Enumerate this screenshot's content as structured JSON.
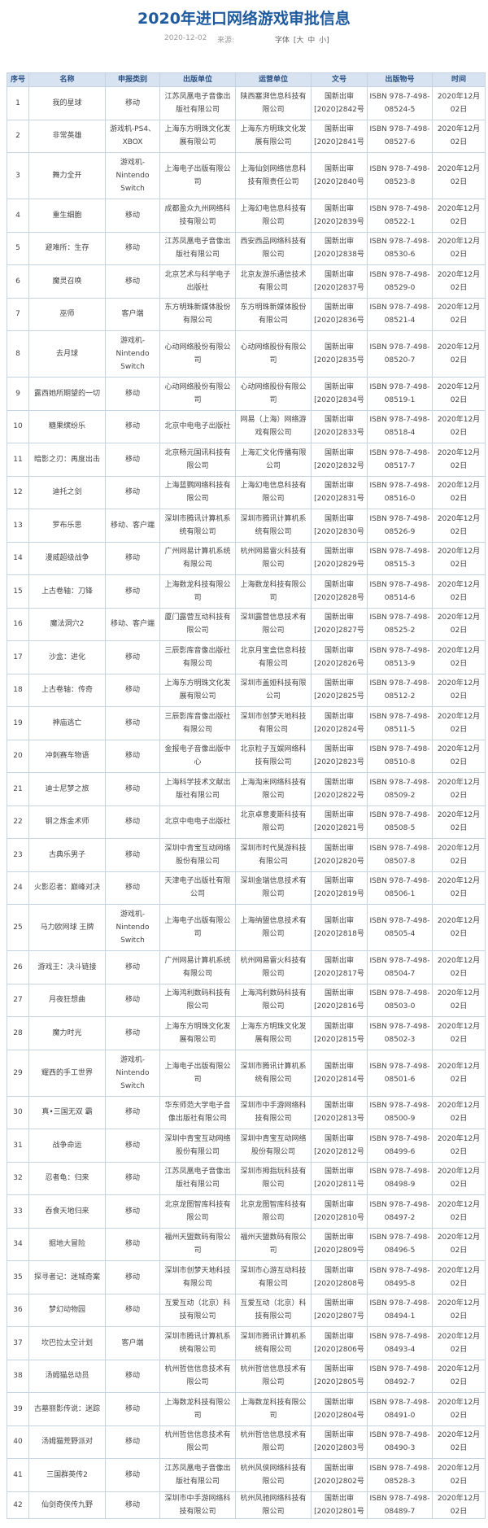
{
  "title": "2020年进口网络游戏审批信息",
  "meta": {
    "date": "2020-12-02",
    "source_label": "来源:",
    "font_label": "字体",
    "font_sizes": [
      "[大",
      "中",
      "小]"
    ]
  },
  "headers": [
    "序号",
    "名称",
    "申报类别",
    "出版单位",
    "运营单位",
    "文号",
    "出版物号",
    "时间"
  ],
  "rows": [
    [
      "1",
      "我的星球",
      "移动",
      "江苏凤凰电子音像出版社有限公司",
      "陕西塞湃信息科技有限公司",
      "国新出审[2020]2842号",
      "ISBN 978-7-498-08524-5",
      "2020年12月02日"
    ],
    [
      "2",
      "非常英雄",
      "游戏机-PS4、XBOX",
      "上海东方明珠文化发展有限公司",
      "上海东方明珠文化发展有限公司",
      "国新出审[2020]2841号",
      "ISBN 978-7-498-08527-6",
      "2020年12月02日"
    ],
    [
      "3",
      "舞力全开",
      "游戏机-Nintendo Switch",
      "上海电子出版有限公司",
      "上海仙剑网络信息科技有限责任公司",
      "国新出审[2020]2840号",
      "ISBN 978-7-498-08523-8",
      "2020年12月02日"
    ],
    [
      "4",
      "重生细胞",
      "移动",
      "成都盈众九州网络科技有限公司",
      "上海幻电信息科技有限公司",
      "国新出审[2020]2839号",
      "ISBN 978-7-498-08522-1",
      "2020年12月02日"
    ],
    [
      "5",
      "避难所：生存",
      "移动",
      "江苏凤凰电子音像出版社有限公司",
      "西安西品网络科技有限公司",
      "国新出审[2020]2838号",
      "ISBN 978-7-498-08530-6",
      "2020年12月02日"
    ],
    [
      "6",
      "魔灵召唤",
      "移动",
      "北京艺术与科学电子出版社",
      "北京友游乐通信技术有限公司",
      "国新出审[2020]2837号",
      "ISBN 978-7-498-08529-0",
      "2020年12月02日"
    ],
    [
      "7",
      "巫师",
      "客户端",
      "东方明珠新媒体股份有限公司",
      "东方明珠新媒体股份有限公司",
      "国新出审[2020]2836号",
      "ISBN 978-7-498-08521-4",
      "2020年12月02日"
    ],
    [
      "8",
      "去月球",
      "游戏机-Nintendo Switch",
      "心动网络股份有限公司",
      "心动网络股份有限公司",
      "国新出审[2020]2835号",
      "ISBN 978-7-498-08520-7",
      "2020年12月02日"
    ],
    [
      "9",
      "露西她所期望的一切",
      "移动",
      "心动网络股份有限公司",
      "心动网络股份有限公司",
      "国新出审[2020]2834号",
      "ISBN 978-7-498-08519-1",
      "2020年12月02日"
    ],
    [
      "10",
      "糖果缤纷乐",
      "移动",
      "北京中电电子出版社",
      "网易（上海）网络游戏有限公司",
      "国新出审[2020]2833号",
      "ISBN 978-7-498-08518-4",
      "2020年12月02日"
    ],
    [
      "11",
      "暗影之刃：再度出击",
      "移动",
      "北京畅元国讯科技有限公司",
      "上海汇文化传播有限公司",
      "国新出审[2020]2832号",
      "ISBN 978-7-498-08517-7",
      "2020年12月02日"
    ],
    [
      "12",
      "迪托之剑",
      "移动",
      "上海蓝鹦网络科技有限公司",
      "上海幻电信息科技有限公司",
      "国新出审[2020]2831号",
      "ISBN 978-7-498-08516-0",
      "2020年12月02日"
    ],
    [
      "13",
      "罗布乐思",
      "移动、客户端",
      "深圳市腾讯计算机系统有限公司",
      "深圳市腾讯计算机系统有限公司",
      "国新出审[2020]2830号",
      "ISBN 978-7-498-08526-9",
      "2020年12月02日"
    ],
    [
      "14",
      "漫威超级战争",
      "移动",
      "广州网易计算机系统有限公司",
      "杭州网易雷火科技有限公司",
      "国新出审[2020]2829号",
      "ISBN 978-7-498-08515-3",
      "2020年12月02日"
    ],
    [
      "15",
      "上古卷轴：刀锋",
      "移动",
      "上海数龙科技有限公司",
      "上海数龙科技有限公司",
      "国新出审[2020]2828号",
      "ISBN 978-7-498-08514-6",
      "2020年12月02日"
    ],
    [
      "16",
      "魔法洞穴2",
      "移动、客户端",
      "厦门露营互动科技有限公司",
      "深圳露营信息技术有限公司",
      "国新出审[2020]2827号",
      "ISBN 978-7-498-08525-2",
      "2020年12月02日"
    ],
    [
      "17",
      "沙盒：进化",
      "移动",
      "三辰影库音像出版社有限公司",
      "北京月宝盒信息科技有限公司",
      "国新出审[2020]2826号",
      "ISBN 978-7-498-08513-9",
      "2020年12月02日"
    ],
    [
      "18",
      "上古卷轴：传奇",
      "移动",
      "上海东方明珠文化发展有限公司",
      "深圳市盖娅科技有限公司",
      "国新出审[2020]2825号",
      "ISBN 978-7-498-08512-2",
      "2020年12月02日"
    ],
    [
      "19",
      "神庙逃亡",
      "移动",
      "三辰影库音像出版社有限公司",
      "深圳市创梦天地科技有限公司",
      "国新出审[2020]2824号",
      "ISBN 978-7-498-08511-5",
      "2020年12月02日"
    ],
    [
      "20",
      "冲刺赛车物语",
      "移动",
      "金报电子音像出版中心",
      "北京粒子互娱网络科技有限公司",
      "国新出审[2020]2823号",
      "ISBN 978-7-498-08510-8",
      "2020年12月02日"
    ],
    [
      "21",
      "迪士尼梦之旅",
      "移动",
      "上海科学技术文献出版社有限公司",
      "上海淘米网络科技有限公司",
      "国新出审[2020]2822号",
      "ISBN 978-7-498-08509-2",
      "2020年12月02日"
    ],
    [
      "22",
      "钢之炼金术师",
      "移动",
      "北京中电电子出版社",
      "北京卓意麦斯科技有限公司",
      "国新出审[2020]2821号",
      "ISBN 978-7-498-08508-5",
      "2020年12月02日"
    ],
    [
      "23",
      "古典乐男子",
      "移动",
      "深圳中青宝互动网络股份有限公司",
      "深圳市时代昊游科技有限公司",
      "国新出审[2020]2820号",
      "ISBN 978-7-498-08507-8",
      "2020年12月02日"
    ],
    [
      "24",
      "火影忍者：巅峰对决",
      "移动",
      "天津电子出版社有限公司",
      "深圳金瑞信息技术有限公司",
      "国新出审[2020]2819号",
      "ISBN 978-7-498-08506-1",
      "2020年12月02日"
    ],
    [
      "25",
      "马力欧网球 王牌",
      "游戏机-Nintendo Switch",
      "上海电子出版有限公司",
      "上海纳盟信息技术有限公司",
      "国新出审[2020]2818号",
      "ISBN 978-7-498-08505-4",
      "2020年12月02日"
    ],
    [
      "26",
      "游戏王：决斗链接",
      "移动",
      "广州网易计算机系统有限公司",
      "杭州网易雷火科技有限公司",
      "国新出审[2020]2817号",
      "ISBN 978-7-498-08504-7",
      "2020年12月02日"
    ],
    [
      "27",
      "月夜狂想曲",
      "移动",
      "上海鸿利数码科技有限公司",
      "上海鸿利数码科技有限公司",
      "国新出审[2020]2816号",
      "ISBN 978-7-498-08503-0",
      "2020年12月02日"
    ],
    [
      "28",
      "魔力时光",
      "移动",
      "上海东方明珠文化发展有限公司",
      "上海东方明珠文化发展有限公司",
      "国新出审[2020]2815号",
      "ISBN 978-7-498-08502-3",
      "2020年12月02日"
    ],
    [
      "29",
      "耀西的手工世界",
      "游戏机-Nintendo Switch",
      "上海电子出版有限公司",
      "深圳市腾讯计算机系统有限公司",
      "国新出审[2020]2814号",
      "ISBN 978-7-498-08501-6",
      "2020年12月02日"
    ],
    [
      "30",
      "真•三国无双 霸",
      "移动",
      "华东师范大学电子音像出版社有限公司",
      "深圳市中手游网络科技有限公司",
      "国新出审[2020]2813号",
      "ISBN 978-7-498-08500-9",
      "2020年12月02日"
    ],
    [
      "31",
      "战争命运",
      "移动",
      "深圳中青宝互动网络股份有限公司",
      "深圳中青宝互动网络股份有限公司",
      "国新出审[2020]2812号",
      "ISBN 978-7-498-08499-6",
      "2020年12月02日"
    ],
    [
      "32",
      "忍者龟：归来",
      "移动",
      "江苏凤凰电子音像出版社有限公司",
      "深圳市拇指玩科技有限公司",
      "国新出审[2020]2811号",
      "ISBN 978-7-498-08498-9",
      "2020年12月02日"
    ],
    [
      "33",
      "吞食天地归来",
      "移动",
      "北京龙图智库科技有限公司",
      "北京龙图智库科技有限公司",
      "国新出审[2020]2810号",
      "ISBN 978-7-498-08497-2",
      "2020年12月02日"
    ],
    [
      "34",
      "掘地大冒险",
      "移动",
      "福州天盟数码有限公司",
      "福州天盟数码有限公司",
      "国新出审[2020]2809号",
      "ISBN 978-7-498-08496-5",
      "2020年12月02日"
    ],
    [
      "35",
      "探寻者记：迷城奇案",
      "移动",
      "深圳市创梦天地科技有限公司",
      "深圳市心游互动科技有限公司",
      "国新出审[2020]2808号",
      "ISBN 978-7-498-08495-8",
      "2020年12月02日"
    ],
    [
      "36",
      "梦幻动物园",
      "移动",
      "互爱互动（北京）科技有限公司",
      "互爱互动（北京）科技有限公司",
      "国新出审[2020]2807号",
      "ISBN 978-7-498-08494-1",
      "2020年12月02日"
    ],
    [
      "37",
      "坎巴拉太空计划",
      "客户端",
      "深圳市腾讯计算机系统有限公司",
      "深圳市腾讯计算机系统有限公司",
      "国新出审[2020]2806号",
      "ISBN 978-7-498-08493-4",
      "2020年12月02日"
    ],
    [
      "38",
      "汤姆猫总动员",
      "移动",
      "杭州哲信信息技术有限公司",
      "杭州哲信信息技术有限公司",
      "国新出审[2020]2805号",
      "ISBN 978-7-498-08492-7",
      "2020年12月02日"
    ],
    [
      "39",
      "古墓丽影传说：迷踪",
      "移动",
      "上海数龙科技有限公司",
      "上海数龙科技有限公司",
      "国新出审[2020]2804号",
      "ISBN 978-7-498-08491-0",
      "2020年12月02日"
    ],
    [
      "40",
      "汤姆猫荒野派对",
      "移动",
      "杭州哲信信息技术有限公司",
      "杭州哲信信息技术有限公司",
      "国新出审[2020]2803号",
      "ISBN 978-7-498-08490-3",
      "2020年12月02日"
    ],
    [
      "41",
      "三国群英传2",
      "移动",
      "江苏凤凰电子音像出版社有限公司",
      "杭州风侠网络科技有限公司",
      "国新出审[2020]2802号",
      "ISBN 978-7-498-08528-3",
      "2020年12月02日"
    ],
    [
      "42",
      "仙剑奇侠传九野",
      "移动",
      "深圳市中手游网络科技有限公司",
      "杭州风驰网络科技有限公司",
      "国新出审[2020]2801号",
      "ISBN 978-7-498-08489-7",
      "2020年12月02日"
    ]
  ]
}
